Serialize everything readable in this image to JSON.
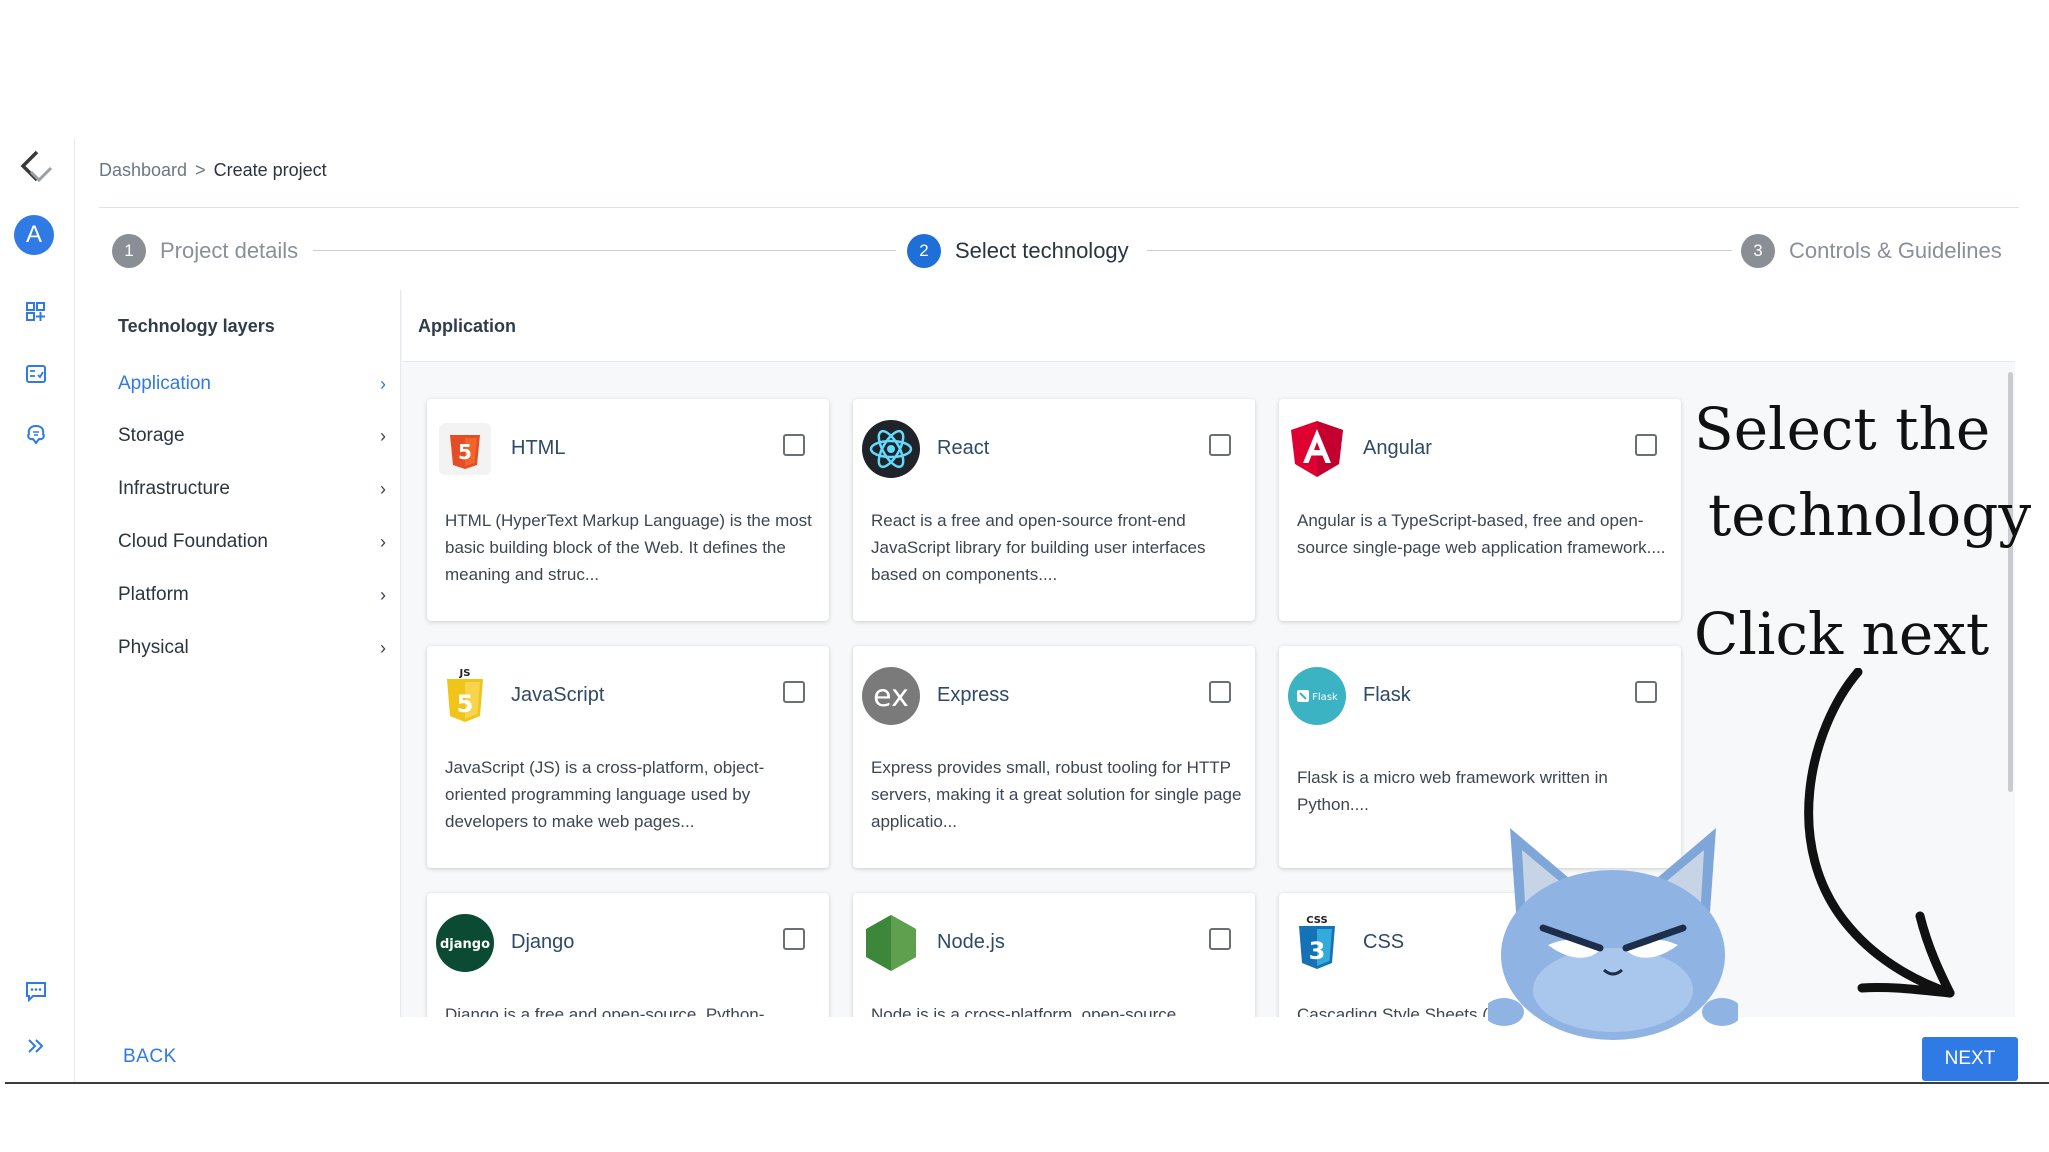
{
  "sidebar_rail": {
    "avatar_letter": "A",
    "icons": [
      "logo-icon",
      "dashboard-grid-icon",
      "checklist-icon",
      "brain-icon",
      "chat-icon",
      "expand-icon"
    ]
  },
  "breadcrumb": {
    "parent": "Dashboard",
    "separator": ">",
    "current": "Create project"
  },
  "stepper": [
    {
      "number": "1",
      "label": "Project details",
      "active": false
    },
    {
      "number": "2",
      "label": "Select technology",
      "active": true
    },
    {
      "number": "3",
      "label": "Controls & Guidelines",
      "active": false
    }
  ],
  "layers": {
    "title": "Technology layers",
    "items": [
      {
        "label": "Application",
        "active": true
      },
      {
        "label": "Storage",
        "active": false
      },
      {
        "label": "Infrastructure",
        "active": false
      },
      {
        "label": "Cloud Foundation",
        "active": false
      },
      {
        "label": "Platform",
        "active": false
      },
      {
        "label": "Physical",
        "active": false
      }
    ],
    "chevron": "›"
  },
  "content": {
    "header": "Application",
    "cards": [
      {
        "name": "HTML",
        "icon": "html5-icon",
        "desc": "HTML (HyperText Markup Language) is the most basic building block of the Web. It defines the meaning and struc...",
        "checked": false
      },
      {
        "name": "React",
        "icon": "react-icon",
        "desc": "React is a free and open-source front-end JavaScript library for building user interfaces based on components....",
        "checked": false
      },
      {
        "name": "Angular",
        "icon": "angular-icon",
        "desc": "Angular is a TypeScript-based, free and open-source single-page web application framework....",
        "checked": false
      },
      {
        "name": "JavaScript",
        "icon": "javascript-icon",
        "desc": "JavaScript (JS) is a cross-platform, object-oriented programming language used by developers to make web pages...",
        "checked": false
      },
      {
        "name": "Express",
        "icon": "express-icon",
        "desc": "Express provides small, robust tooling for HTTP servers, making it a great solution for single page applicatio...",
        "checked": false
      },
      {
        "name": "Flask",
        "icon": "flask-icon",
        "desc": "Flask is a micro web framework written in Python....",
        "checked": false
      },
      {
        "name": "Django",
        "icon": "django-icon",
        "desc": "Django is a free and open-source, Python-",
        "checked": false
      },
      {
        "name": "Node.js",
        "icon": "nodejs-icon",
        "desc": "Node.js is a cross-platform, open-source",
        "checked": false
      },
      {
        "name": "CSS",
        "icon": "css3-icon",
        "desc": "Cascading Style Sheets (C",
        "checked": false
      }
    ]
  },
  "actions": {
    "back": "BACK",
    "next": "NEXT"
  },
  "annotation": {
    "line1": "Select the",
    "line2": "technology",
    "line3": "Click next"
  },
  "colors": {
    "accent": "#2f7ae5",
    "step_active": "#1f6fd8",
    "step_inactive": "#8a8f96"
  }
}
